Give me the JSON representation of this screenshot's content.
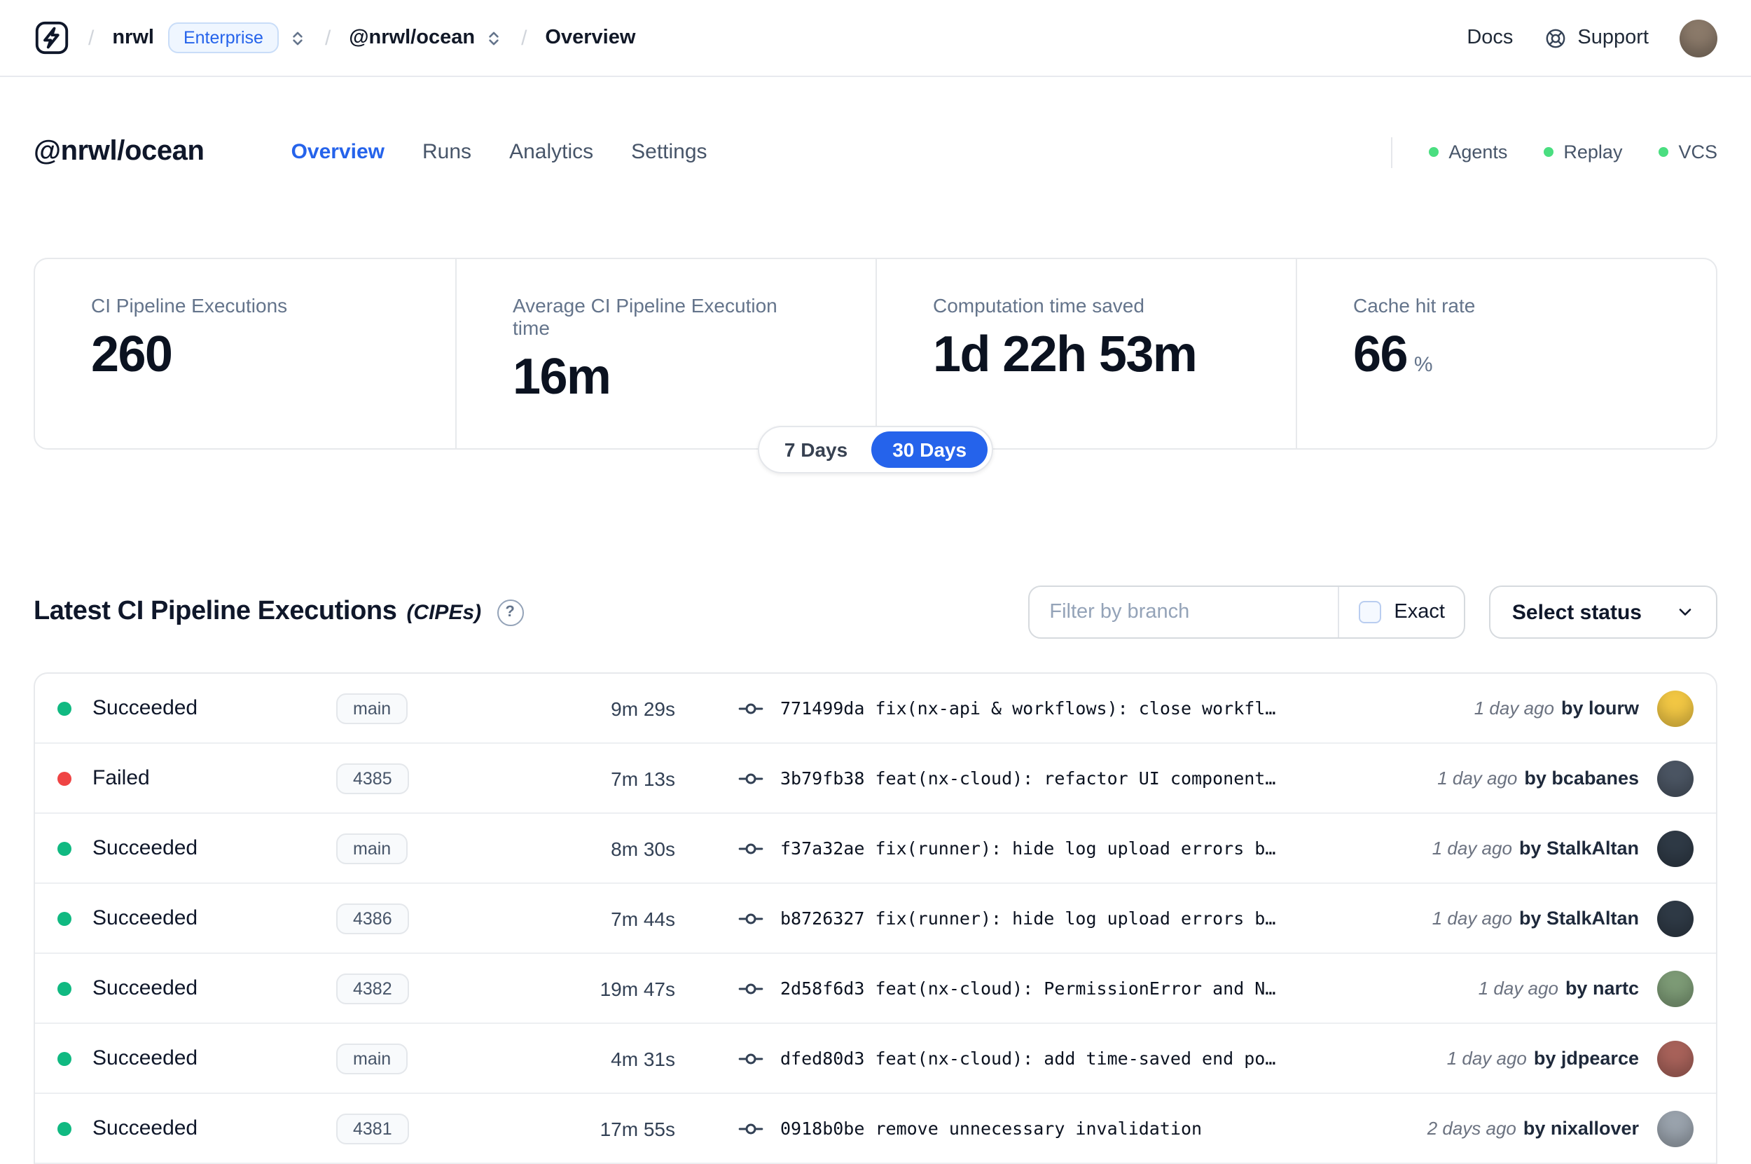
{
  "theme": {
    "accent": "#2563eb",
    "success": "#10b981",
    "danger": "#ef4444",
    "online_dot": "#4ade80"
  },
  "navbar": {
    "breadcrumb": {
      "separator": "/",
      "org": "nrwl",
      "org_badge": "Enterprise",
      "workspace": "@nrwl/ocean",
      "page": "Overview"
    },
    "docs_label": "Docs",
    "support_label": "Support",
    "avatar_color": "#8b7a6a"
  },
  "workspace": {
    "title": "@nrwl/ocean",
    "active_tab": "Overview",
    "tabs": [
      {
        "label": "Overview"
      },
      {
        "label": "Runs"
      },
      {
        "label": "Analytics"
      },
      {
        "label": "Settings"
      }
    ],
    "status_links": [
      {
        "label": "Agents"
      },
      {
        "label": "Replay"
      },
      {
        "label": "VCS"
      }
    ]
  },
  "stats": [
    {
      "label": "CI Pipeline Executions",
      "value": "260"
    },
    {
      "label": "Average CI Pipeline Execution time",
      "value": "16m"
    },
    {
      "label": "Computation time saved",
      "value": "1d 22h 53m"
    },
    {
      "label": "Cache hit rate",
      "value": "66",
      "unit": "%"
    }
  ],
  "range_toggle": {
    "options": [
      "7 Days",
      "30 Days"
    ],
    "active": "30 Days"
  },
  "cipe": {
    "title": "Latest CI Pipeline Executions",
    "suffix": "(CIPEs)",
    "help_icon": "?",
    "filter_placeholder": "Filter by branch",
    "exact_label": "Exact",
    "status_button": "Select status"
  },
  "executions": [
    {
      "status": "Succeeded",
      "status_color": "#10b981",
      "branch": "main",
      "duration": "9m 29s",
      "commit": "771499da fix(nx-api & workflows): close workfl…",
      "time": "1 day ago",
      "author": "by lourw",
      "avatar_color": "#f2c744"
    },
    {
      "status": "Failed",
      "status_color": "#ef4444",
      "branch": "4385",
      "duration": "7m 13s",
      "commit": "3b79fb38 feat(nx-cloud): refactor UI component…",
      "time": "1 day ago",
      "author": "by bcabanes",
      "avatar_color": "#4b5563"
    },
    {
      "status": "Succeeded",
      "status_color": "#10b981",
      "branch": "main",
      "duration": "8m 30s",
      "commit": "f37a32ae fix(runner): hide log upload errors b…",
      "time": "1 day ago",
      "author": "by StalkAltan",
      "avatar_color": "#2f3a46"
    },
    {
      "status": "Succeeded",
      "status_color": "#10b981",
      "branch": "4386",
      "duration": "7m 44s",
      "commit": "b8726327 fix(runner): hide log upload errors b…",
      "time": "1 day ago",
      "author": "by StalkAltan",
      "avatar_color": "#2f3a46"
    },
    {
      "status": "Succeeded",
      "status_color": "#10b981",
      "branch": "4382",
      "duration": "19m 47s",
      "commit": "2d58f6d3 feat(nx-cloud): PermissionError and N…",
      "time": "1 day ago",
      "author": "by nartc",
      "avatar_color": "#7d9b76"
    },
    {
      "status": "Succeeded",
      "status_color": "#10b981",
      "branch": "main",
      "duration": "4m 31s",
      "commit": "dfed80d3 feat(nx-cloud): add time-saved end po…",
      "time": "1 day ago",
      "author": "by jdpearce",
      "avatar_color": "#a8625a"
    },
    {
      "status": "Succeeded",
      "status_color": "#10b981",
      "branch": "4381",
      "duration": "17m 55s",
      "commit": "0918b0be remove unnecessary invalidation",
      "time": "2 days ago",
      "author": "by nixallover",
      "avatar_color": "#9aa3ad"
    }
  ]
}
